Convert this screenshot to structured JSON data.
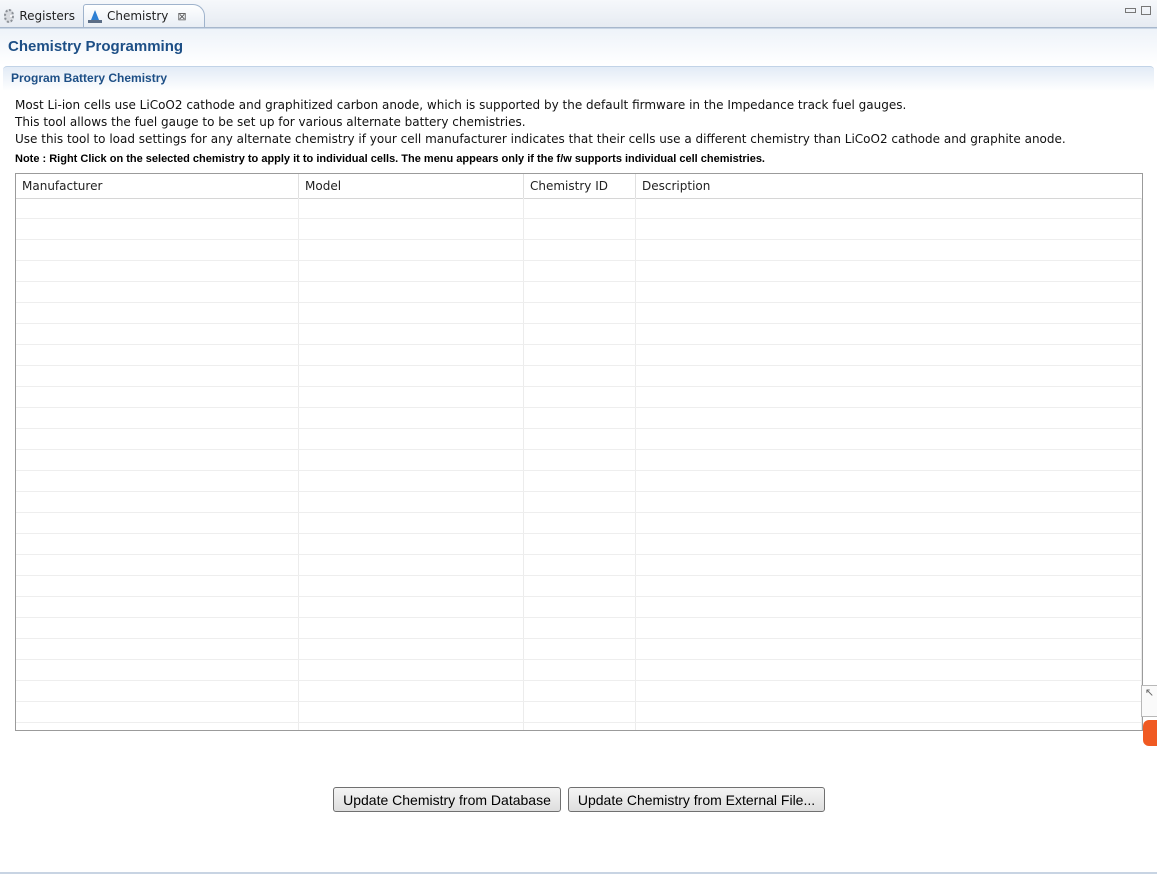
{
  "tabs": {
    "registers_label": "Registers",
    "chemistry_label": "Chemistry",
    "close_glyph": "⊠"
  },
  "form": {
    "title": "Chemistry Programming"
  },
  "section": {
    "title": "Program Battery Chemistry",
    "description_lines": [
      "Most Li-ion cells use LiCoO2 cathode and graphitized carbon anode, which is supported by the default firmware in the Impedance track fuel gauges.",
      "This tool allows the fuel gauge to be set up for various alternate battery chemistries.",
      "Use this tool to load settings for any alternate chemistry if your cell manufacturer indicates that their cells use a different chemistry than LiCoO2 cathode and graphite anode."
    ],
    "note": "Note : Right Click on the selected chemistry to apply it to individual cells. The menu appears only if the f/w supports individual cell chemistries."
  },
  "table": {
    "columns": [
      "Manufacturer",
      "Model",
      "Chemistry ID",
      "Description"
    ]
  },
  "buttons": {
    "update_db": "Update Chemistry from Database",
    "update_file": "Update Chemistry from External File..."
  },
  "side_widget": {
    "glyph": "↖"
  }
}
